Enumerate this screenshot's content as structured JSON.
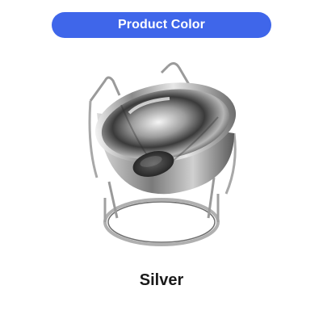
{
  "header": {
    "title": "Product Color"
  },
  "product": {
    "image_icon": "silver-bowl-on-stand",
    "color_name": "Silver"
  },
  "colors": {
    "header_background": "#3f66ea",
    "header_text": "#ffffff",
    "label_text": "#1a1a1a"
  }
}
